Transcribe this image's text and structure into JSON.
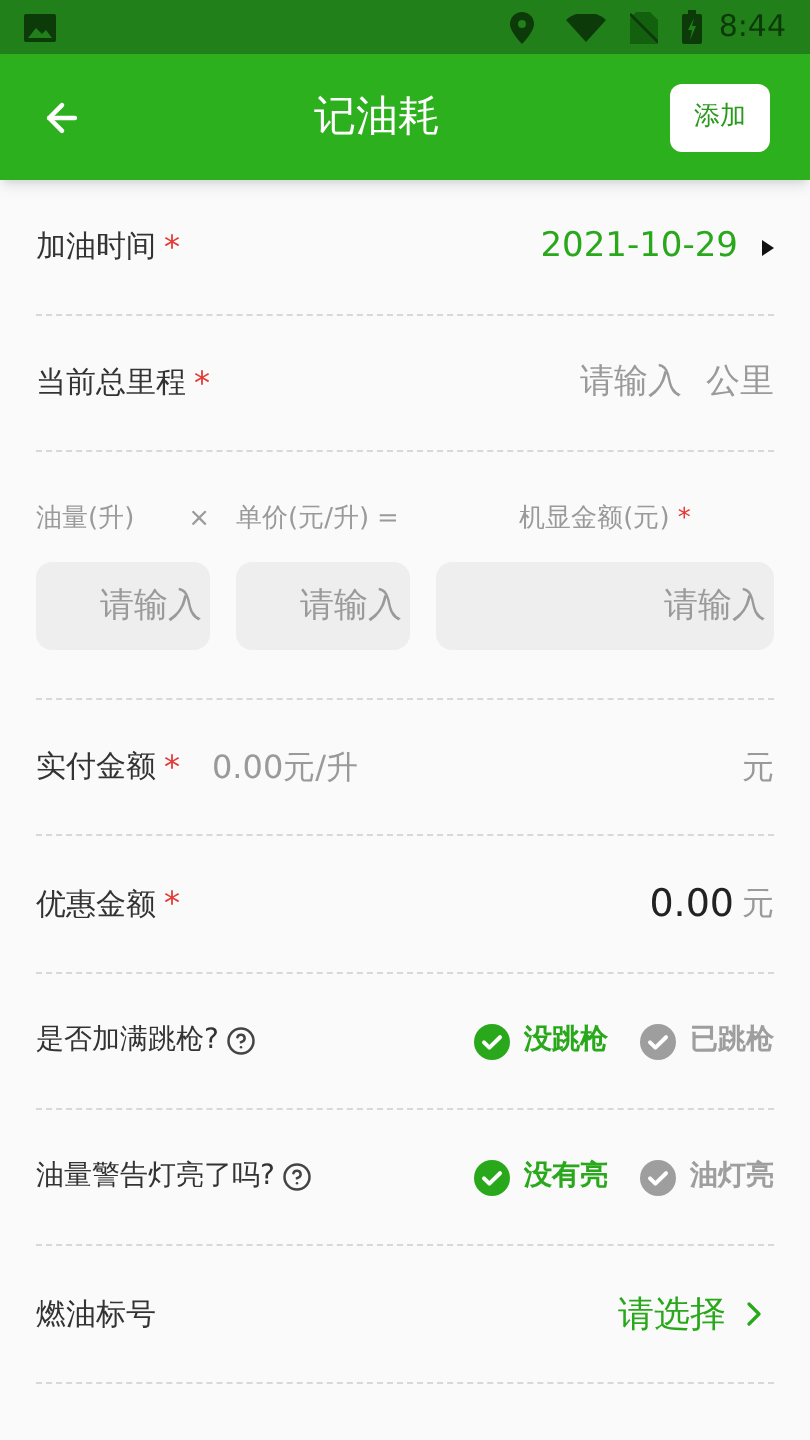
{
  "status_bar": {
    "time": "8:44"
  },
  "app_bar": {
    "title": "记油耗",
    "action": "添加"
  },
  "date_row": {
    "label": "加油时间",
    "required_mark": "*",
    "value": "2021-10-29"
  },
  "mileage_row": {
    "label": "当前总里程",
    "required_mark": "*",
    "placeholder": "请输入",
    "unit": "公里"
  },
  "fuel_calc": [
    {
      "label": "油量(升)",
      "operator": "×",
      "placeholder": "请输入"
    },
    {
      "label": "单价(元/升)",
      "operator": "=",
      "placeholder": "请输入"
    },
    {
      "label": "机显金额(元)",
      "required_mark": "*",
      "placeholder": "请输入"
    }
  ],
  "paid_row": {
    "label": "实付金额",
    "required_mark": "*",
    "hint": "0.00元/升",
    "unit": "元"
  },
  "discount_row": {
    "label": "优惠金额",
    "required_mark": "*",
    "value": "0.00",
    "unit": "元"
  },
  "choice_rows": [
    {
      "label": "是否加满跳枪?",
      "options": [
        {
          "label": "没跳枪",
          "selected": true
        },
        {
          "label": "已跳枪",
          "selected": false
        }
      ]
    },
    {
      "label": "油量警告灯亮了吗?",
      "options": [
        {
          "label": "没有亮",
          "selected": true
        },
        {
          "label": "油灯亮",
          "selected": false
        }
      ]
    }
  ],
  "fuel_type_row": {
    "label": "燃油标号",
    "value": "请选择"
  }
}
